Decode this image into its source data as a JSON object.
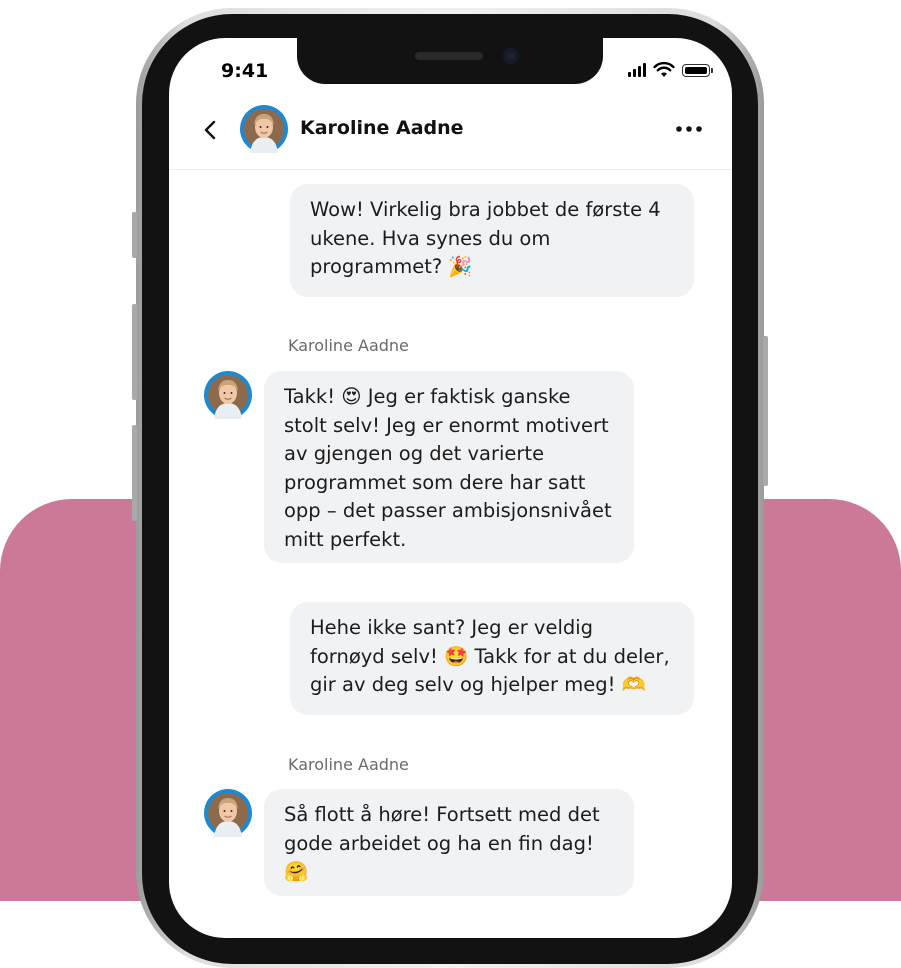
{
  "status_bar": {
    "time": "9:41"
  },
  "header": {
    "contact_name": "Karoline Aadne"
  },
  "messages": [
    {
      "direction": "outgoing",
      "text": "Wow! Virkelig bra jobbet de første 4\nukene. Hva synes du om\nprogrammet? 🎉"
    },
    {
      "direction": "incoming",
      "sender": "Karoline Aadne",
      "text": "Takk! 😍 Jeg er faktisk ganske\nstolt selv! Jeg er enormt motivert\nav gjengen og det varierte\nprogrammet som dere har satt\nopp – det passer ambisjonsnivået\nmitt perfekt."
    },
    {
      "direction": "outgoing",
      "text": "Hehe ikke sant? Jeg er veldig\nfornøyd selv! 🤩 Takk for at du deler,\ngir av deg selv og hjelper meg! 🫶"
    },
    {
      "direction": "incoming",
      "sender": "Karoline Aadne",
      "text": "Så flott å høre! Fortsett med det\ngode arbeidet og ha en fin dag!\n🤗"
    }
  ],
  "icons": {
    "back": "chevron-left-icon",
    "more": "more-horizontal-icon",
    "signal": "signal-icon",
    "wifi": "wifi-icon",
    "battery": "battery-icon"
  },
  "colors": {
    "background_card": "#cc7898",
    "bubble": "#f1f2f4",
    "avatar_ring": "#1e88d0"
  }
}
